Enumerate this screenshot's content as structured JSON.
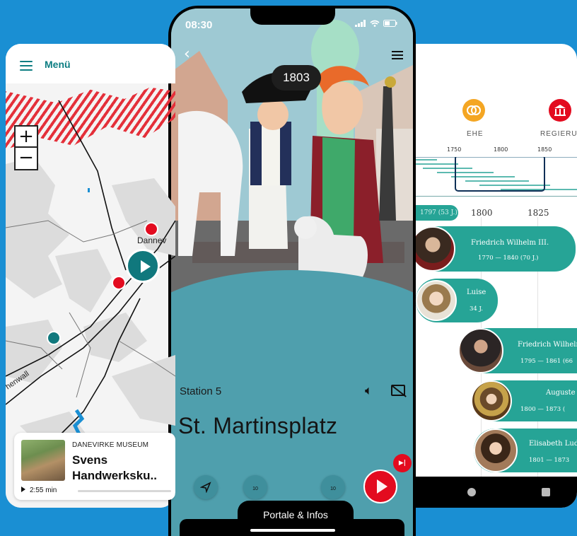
{
  "map_screen": {
    "menu_label": "Menü",
    "zoom_in": "+",
    "zoom_out": "−",
    "place_label": "Dannev",
    "road_label": "henwall",
    "mini_player": {
      "museum": "DANEVIRKE MUSEUM",
      "title": "Svens Handwerksku..",
      "duration": "2:55 min"
    }
  },
  "player_screen": {
    "time": "08:30",
    "year_badge": "1803",
    "station": "Station 5",
    "title": "St. Martinsplatz",
    "rewind_label": "10",
    "forward_label": "10",
    "portale_tab": "Portale & Infos",
    "accent_color": "#e30b1f",
    "panel_color": "#4f9fad"
  },
  "timeline_screen": {
    "categories": [
      {
        "label": "EHE",
        "icon": "rings-icon",
        "color": "#f4a623"
      },
      {
        "label": "REGIERUN",
        "icon": "government-building-icon",
        "color": "#e30b1f"
      }
    ],
    "minimap_years": [
      "1750",
      "1800",
      "1850"
    ],
    "axis_labels": [
      "1800",
      "1825"
    ],
    "first_partial": "1797 (53 J.)",
    "people": [
      {
        "name": "Friedrich Wilhelm III.",
        "dates": "1770 — 1840 (70 J.)"
      },
      {
        "name": "Luise",
        "dates": "34 J."
      },
      {
        "name": "Friedrich Wilhelm",
        "dates": "1795 — 1861 (66"
      },
      {
        "name": "Auguste",
        "dates": "1800 — 1873 ("
      },
      {
        "name": "Elisabeth Lud",
        "dates": "1801 — 1873"
      }
    ],
    "pill_color": "#26a496"
  }
}
